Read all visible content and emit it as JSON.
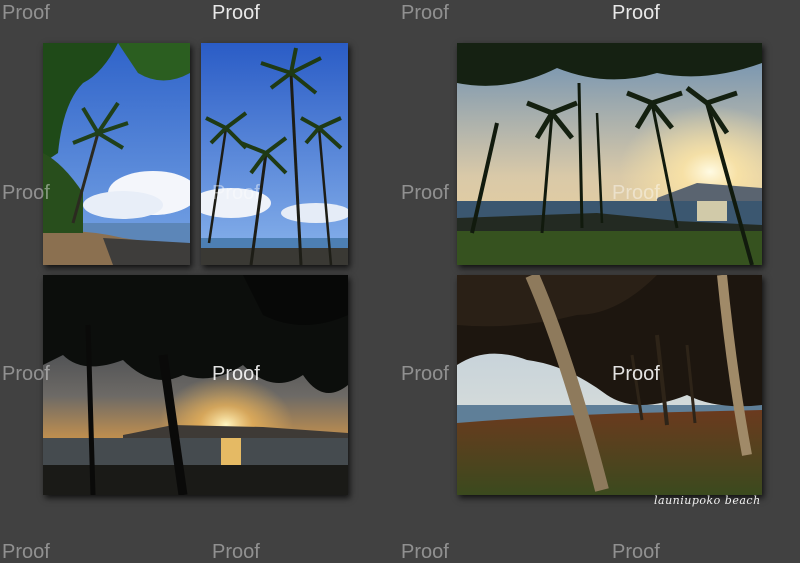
{
  "watermark_text": "Proof",
  "caption": "launiupoko beach",
  "photos": [
    {
      "subject": "palm trees and rocky shore, blue sky"
    },
    {
      "subject": "tall palm trees against blue sky"
    },
    {
      "subject": "palm silhouettes at sunset over ocean"
    },
    {
      "subject": "tree silhouettes at sunset over ocean"
    },
    {
      "subject": "leaning trunks under canopy at the beach"
    }
  ]
}
